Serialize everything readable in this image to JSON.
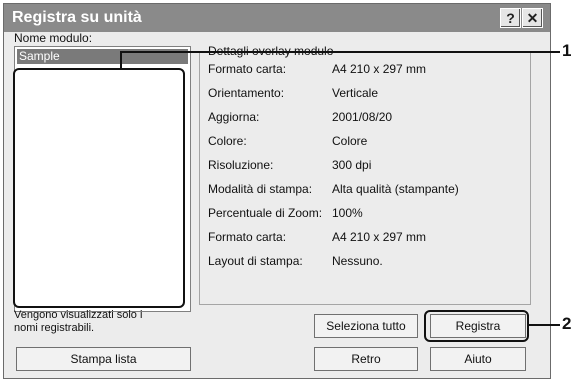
{
  "window": {
    "title": "Registra su unità",
    "help_icon": "?",
    "close_icon": "✕"
  },
  "form_list": {
    "label": "Nome modulo:",
    "selected_item": "Sample"
  },
  "details": {
    "group_title": "Dettagli overlay modulo",
    "rows": [
      {
        "label": "Formato carta:",
        "value": "A4 210 x 297 mm"
      },
      {
        "label": "Orientamento:",
        "value": "Verticale"
      },
      {
        "label": "Aggiorna:",
        "value": "2001/08/20"
      },
      {
        "label": "Colore:",
        "value": "Colore"
      },
      {
        "label": "Risoluzione:",
        "value": "300 dpi"
      },
      {
        "label": "Modalità di stampa:",
        "value": "Alta qualità (stampante)"
      },
      {
        "label": "Percentuale di Zoom:",
        "value": "100%"
      },
      {
        "label": "Formato carta:",
        "value": "A4 210 x 297 mm"
      },
      {
        "label": "Layout di stampa:",
        "value": "Nessuno."
      }
    ]
  },
  "note": {
    "line1": "Vengono visualizzati solo i",
    "line2": "nomi registrabili."
  },
  "buttons": {
    "print_list": "Stampa lista",
    "select_all": "Seleziona tutto",
    "register": "Registra",
    "back": "Retro",
    "help": "Aiuto"
  },
  "callouts": {
    "one": "1",
    "two": "2"
  }
}
